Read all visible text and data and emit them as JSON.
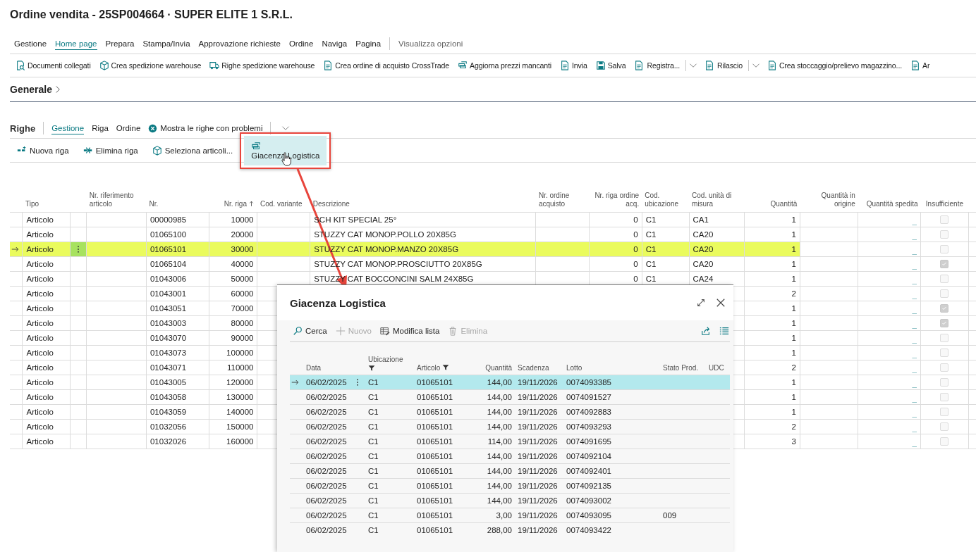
{
  "page": {
    "title": "Ordine vendita - 25SP004664 · SUPER ELITE 1 S.R.L."
  },
  "menu_tabs": [
    {
      "label": "Gestione",
      "selected": false
    },
    {
      "label": "Home page",
      "selected": true
    },
    {
      "label": "Prepara",
      "selected": false
    },
    {
      "label": "Stampa/Invia",
      "selected": false
    },
    {
      "label": "Approvazione richieste",
      "selected": false
    },
    {
      "label": "Ordine",
      "selected": false
    },
    {
      "label": "Naviga",
      "selected": false
    },
    {
      "label": "Pagina",
      "selected": false
    }
  ],
  "view_options": "Visualizza opzioni",
  "actions": [
    {
      "label": "Documenti collegati",
      "split": false
    },
    {
      "label": "Crea spedizione warehouse",
      "split": false
    },
    {
      "label": "Righe spedizione warehouse",
      "split": false
    },
    {
      "label": "Crea ordine di acquisto CrossTrade",
      "split": false
    },
    {
      "label": "Aggiorna prezzi mancanti",
      "split": false
    },
    {
      "label": "Invia",
      "split": false
    },
    {
      "label": "Salva",
      "split": false
    },
    {
      "label": "Registra...",
      "split": true
    },
    {
      "label": "Rilascio",
      "split": true
    },
    {
      "label": "Crea stoccaggio/prelievo magazzino...",
      "split": false
    },
    {
      "label": "Ar",
      "split": false
    }
  ],
  "section": {
    "label": "Generale"
  },
  "lines": {
    "title": "Righe",
    "tabs": [
      {
        "label": "Gestione",
        "selected": true
      },
      {
        "label": "Riga",
        "selected": false
      },
      {
        "label": "Ordine",
        "selected": false
      }
    ],
    "filter_action": "Mostra le righe con problemi",
    "actions": [
      {
        "label": "Nuova riga",
        "highlighted": false
      },
      {
        "label": "Elimina riga",
        "highlighted": false
      },
      {
        "label": "Seleziona articoli...",
        "highlighted": false
      },
      {
        "label": "Giacenza Logistica",
        "highlighted": true
      }
    ],
    "table": {
      "columns": [
        {
          "label": "Tipo",
          "sorted": false
        },
        {
          "label": "Nr. riferimento articolo",
          "sorted": false
        },
        {
          "label": "Nr.",
          "sorted": false
        },
        {
          "label": "Nr. riga",
          "sorted": true
        },
        {
          "label": "Cod. variante",
          "sorted": false
        },
        {
          "label": "Descrizione",
          "sorted": false
        },
        {
          "label": "Nr. ordine acquisto",
          "sorted": false
        },
        {
          "label": "Nr. riga ordine acq.",
          "sorted": false
        },
        {
          "label": "Cod. ubicazione",
          "sorted": false
        },
        {
          "label": "Cod. unità di misura",
          "sorted": false
        },
        {
          "label": "Quantità",
          "sorted": false
        },
        {
          "label": "Quantità in origine",
          "sorted": false
        },
        {
          "label": "Quantità spedita",
          "sorted": false
        },
        {
          "label": "Insufficiente",
          "sorted": false
        }
      ],
      "rows": [
        {
          "selected": false,
          "tipo": "Articolo",
          "nr": "00000985",
          "riga": "10000",
          "descrizione": "SCH KIT SPECIAL 25°",
          "riga_acq": "0",
          "ubicazione": "C1",
          "unita": "CA1",
          "quantita": "1",
          "spedita": "_",
          "insufficiente": false
        },
        {
          "selected": false,
          "tipo": "Articolo",
          "nr": "01065100",
          "riga": "20000",
          "descrizione": "STUZZY CAT MONOP.POLLO 20X85G",
          "riga_acq": "0",
          "ubicazione": "C1",
          "unita": "CA20",
          "quantita": "1",
          "spedita": "_",
          "insufficiente": false
        },
        {
          "selected": true,
          "tipo": "Articolo",
          "nr": "01065101",
          "riga": "30000",
          "descrizione": "STUZZY CAT MONOP.MANZO 20X85G",
          "riga_acq": "0",
          "ubicazione": "C1",
          "unita": "CA20",
          "quantita": "1",
          "spedita": "_",
          "insufficiente": false
        },
        {
          "selected": false,
          "tipo": "Articolo",
          "nr": "01065104",
          "riga": "40000",
          "descrizione": "STUZZY CAT MONOP.PROSCIUTTO 20X85G",
          "riga_acq": "0",
          "ubicazione": "C1",
          "unita": "CA20",
          "quantita": "1",
          "spedita": "_",
          "insufficiente": true
        },
        {
          "selected": false,
          "tipo": "Articolo",
          "nr": "01043006",
          "riga": "50000",
          "descrizione": "STUZZY CAT BOCCONCINI SALM 24X85G",
          "riga_acq": "0",
          "ubicazione": "C1",
          "unita": "CA24",
          "quantita": "1",
          "spedita": "_",
          "insufficiente": false
        },
        {
          "selected": false,
          "tipo": "Articolo",
          "nr": "01043001",
          "riga": "60000",
          "quantita": "2",
          "spedita": "_",
          "insufficiente": false
        },
        {
          "selected": false,
          "tipo": "Articolo",
          "nr": "01043051",
          "riga": "70000",
          "quantita": "1",
          "spedita": "_",
          "insufficiente": true
        },
        {
          "selected": false,
          "tipo": "Articolo",
          "nr": "01043003",
          "riga": "80000",
          "quantita": "1",
          "spedita": "_",
          "insufficiente": true
        },
        {
          "selected": false,
          "tipo": "Articolo",
          "nr": "01043070",
          "riga": "90000",
          "quantita": "1",
          "spedita": "_",
          "insufficiente": false
        },
        {
          "selected": false,
          "tipo": "Articolo",
          "nr": "01043073",
          "riga": "100000",
          "quantita": "1",
          "spedita": "_",
          "insufficiente": false
        },
        {
          "selected": false,
          "tipo": "Articolo",
          "nr": "01043071",
          "riga": "110000",
          "quantita": "2",
          "spedita": "_",
          "insufficiente": false
        },
        {
          "selected": false,
          "tipo": "Articolo",
          "nr": "01043005",
          "riga": "120000",
          "quantita": "1",
          "spedita": "_",
          "insufficiente": false
        },
        {
          "selected": false,
          "tipo": "Articolo",
          "nr": "01043058",
          "riga": "130000",
          "quantita": "1",
          "spedita": "_",
          "insufficiente": false
        },
        {
          "selected": false,
          "tipo": "Articolo",
          "nr": "01043059",
          "riga": "140000",
          "quantita": "1",
          "spedita": "_",
          "insufficiente": false
        },
        {
          "selected": false,
          "tipo": "Articolo",
          "nr": "01032056",
          "riga": "150000",
          "quantita": "2",
          "spedita": "_",
          "insufficiente": false
        },
        {
          "selected": false,
          "tipo": "Articolo",
          "nr": "01032026",
          "riga": "160000",
          "quantita": "3",
          "spedita": "_",
          "insufficiente": false
        }
      ]
    }
  },
  "dialog": {
    "title": "Giacenza Logistica",
    "actions": [
      {
        "label": "Cerca",
        "disabled": false
      },
      {
        "label": "Nuovo",
        "disabled": true
      },
      {
        "label": "Modifica lista",
        "disabled": false
      },
      {
        "label": "Elimina",
        "disabled": true
      }
    ],
    "columns": [
      {
        "label": "Data",
        "filtered": false
      },
      {
        "label": "Ubicazione",
        "filtered": true
      },
      {
        "label": "Articolo",
        "filtered": true
      },
      {
        "label": "Quantità",
        "filtered": false
      },
      {
        "label": "Scadenza",
        "filtered": false
      },
      {
        "label": "Lotto",
        "filtered": false
      },
      {
        "label": "Stato Prod.",
        "filtered": false
      },
      {
        "label": "UDC",
        "filtered": false
      }
    ],
    "rows": [
      {
        "selected": true,
        "data": "06/02/2025",
        "ubicazione": "C1",
        "articolo": "01065101",
        "quantita": "144,00",
        "scadenza": "19/11/2026",
        "lotto": "0074093385"
      },
      {
        "selected": false,
        "data": "06/02/2025",
        "ubicazione": "C1",
        "articolo": "01065101",
        "quantita": "144,00",
        "scadenza": "19/11/2026",
        "lotto": "0074091527"
      },
      {
        "selected": false,
        "data": "06/02/2025",
        "ubicazione": "C1",
        "articolo": "01065101",
        "quantita": "144,00",
        "scadenza": "19/11/2026",
        "lotto": "0074092883"
      },
      {
        "selected": false,
        "data": "06/02/2025",
        "ubicazione": "C1",
        "articolo": "01065101",
        "quantita": "144,00",
        "scadenza": "19/11/2026",
        "lotto": "0074093293"
      },
      {
        "selected": false,
        "data": "06/02/2025",
        "ubicazione": "C1",
        "articolo": "01065101",
        "quantita": "114,00",
        "scadenza": "19/11/2026",
        "lotto": "0074091695"
      },
      {
        "selected": false,
        "data": "06/02/2025",
        "ubicazione": "C1",
        "articolo": "01065101",
        "quantita": "144,00",
        "scadenza": "19/11/2026",
        "lotto": "0074092104"
      },
      {
        "selected": false,
        "data": "06/02/2025",
        "ubicazione": "C1",
        "articolo": "01065101",
        "quantita": "144,00",
        "scadenza": "19/11/2026",
        "lotto": "0074092401"
      },
      {
        "selected": false,
        "data": "06/02/2025",
        "ubicazione": "C1",
        "articolo": "01065101",
        "quantita": "144,00",
        "scadenza": "19/11/2026",
        "lotto": "0074092135"
      },
      {
        "selected": false,
        "data": "06/02/2025",
        "ubicazione": "C1",
        "articolo": "01065101",
        "quantita": "144,00",
        "scadenza": "19/11/2026",
        "lotto": "0074093002"
      },
      {
        "selected": false,
        "data": "06/02/2025",
        "ubicazione": "C1",
        "articolo": "01065101",
        "quantita": "3,00",
        "scadenza": "19/11/2026",
        "lotto": "0074093095",
        "stato": "009"
      },
      {
        "selected": false,
        "data": "06/02/2025",
        "ubicazione": "C1",
        "articolo": "01065101",
        "quantita": "288,00",
        "scadenza": "19/11/2026",
        "lotto": "0074093422"
      }
    ]
  }
}
